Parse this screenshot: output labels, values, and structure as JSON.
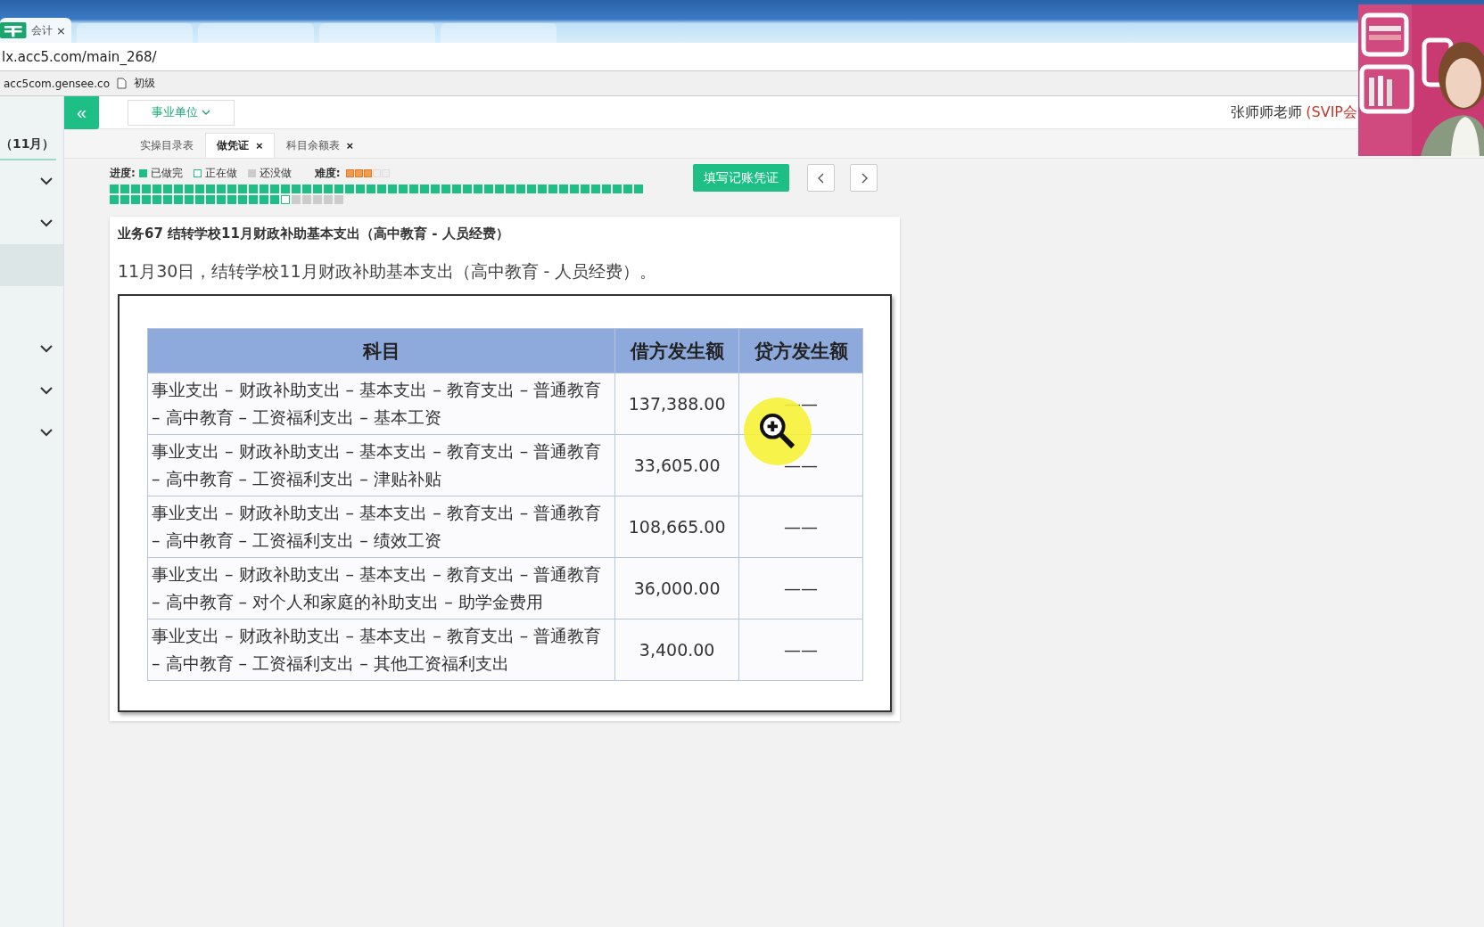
{
  "browser": {
    "tabs": [
      {
        "title": "会计",
        "close": "×",
        "selected": true
      },
      {
        "selected": false
      },
      {
        "selected": false
      },
      {
        "selected": false
      },
      {
        "selected": false
      }
    ],
    "address": "lx.acc5.com/main_268/",
    "bookmarks": [
      {
        "label": "acc5com.gensee.co",
        "kind": "site"
      },
      {
        "label": "初级",
        "kind": "page"
      }
    ]
  },
  "header": {
    "collapse": "«",
    "unit_dropdown": "事业单位",
    "user": "张师师老师",
    "membership": "(SVIP会"
  },
  "tabs": [
    {
      "label": "实操目录表",
      "selected": false
    },
    {
      "label": "做凭证",
      "selected": true,
      "close": "×"
    },
    {
      "label": "科目余额表",
      "selected": false,
      "close": "×"
    }
  ],
  "sidebar": {
    "title": "（11月）",
    "items": [
      {
        "selected": false,
        "kind": "group"
      },
      {
        "selected": false,
        "kind": "group"
      },
      {
        "selected": true,
        "kind": "plain"
      },
      {
        "selected": false,
        "kind": "group"
      },
      {
        "selected": false,
        "kind": "group"
      },
      {
        "selected": false,
        "kind": "group"
      }
    ]
  },
  "progress": {
    "label": "进度:",
    "legend": [
      "已做完",
      "正在做",
      "还没做"
    ],
    "difficulty_label": "难度:",
    "stars": 3,
    "steps": [
      {
        "done": true,
        "current": false
      },
      {
        "done": true,
        "current": false
      },
      {
        "done": true,
        "current": false
      },
      {
        "done": true,
        "current": false
      },
      {
        "done": true,
        "current": false
      },
      {
        "done": true,
        "current": false
      },
      {
        "done": true,
        "current": false
      },
      {
        "done": true,
        "current": false
      },
      {
        "done": true,
        "current": false
      },
      {
        "done": true,
        "current": false
      },
      {
        "done": true,
        "current": false
      },
      {
        "done": true,
        "current": false
      },
      {
        "done": true,
        "current": false
      },
      {
        "done": true,
        "current": false
      },
      {
        "done": true,
        "current": false
      },
      {
        "done": true,
        "current": false
      },
      {
        "done": true,
        "current": false
      },
      {
        "done": true,
        "current": false
      },
      {
        "done": true,
        "current": false
      },
      {
        "done": true,
        "current": false
      },
      {
        "done": true,
        "current": false
      },
      {
        "done": true,
        "current": false
      },
      {
        "done": true,
        "current": false
      },
      {
        "done": true,
        "current": false
      },
      {
        "done": true,
        "current": false
      },
      {
        "done": true,
        "current": false
      },
      {
        "done": true,
        "current": false
      },
      {
        "done": true,
        "current": false
      },
      {
        "done": true,
        "current": false
      },
      {
        "done": true,
        "current": false
      },
      {
        "done": true,
        "current": false
      },
      {
        "done": true,
        "current": false
      },
      {
        "done": true,
        "current": false
      },
      {
        "done": true,
        "current": false
      },
      {
        "done": true,
        "current": false
      },
      {
        "done": true,
        "current": false
      },
      {
        "done": true,
        "current": false
      },
      {
        "done": true,
        "current": false
      },
      {
        "done": true,
        "current": false
      },
      {
        "done": true,
        "current": false
      },
      {
        "done": true,
        "current": false
      },
      {
        "done": true,
        "current": false
      },
      {
        "done": true,
        "current": false
      },
      {
        "done": true,
        "current": false
      },
      {
        "done": true,
        "current": false
      },
      {
        "done": true,
        "current": false
      },
      {
        "done": true,
        "current": false
      },
      {
        "done": true,
        "current": false
      },
      {
        "done": true,
        "current": false
      },
      {
        "done": true,
        "current": false
      },
      {
        "done": true,
        "current": false
      },
      {
        "done": true,
        "current": false
      },
      {
        "done": true,
        "current": false
      },
      {
        "done": true,
        "current": false
      },
      {
        "done": true,
        "current": false
      },
      {
        "done": true,
        "current": false
      },
      {
        "done": true,
        "current": false
      },
      {
        "done": true,
        "current": false
      },
      {
        "done": true,
        "current": false
      },
      {
        "done": true,
        "current": false
      },
      {
        "done": true,
        "current": false
      },
      {
        "done": true,
        "current": false
      },
      {
        "done": true,
        "current": false
      },
      {
        "done": true,
        "current": false
      },
      {
        "done": true,
        "current": false
      },
      {
        "done": true,
        "current": false
      },
      {
        "done": false,
        "current": true
      },
      {
        "done": false,
        "current": false
      },
      {
        "done": false,
        "current": false
      },
      {
        "done": false,
        "current": false
      },
      {
        "done": false,
        "current": false
      },
      {
        "done": false,
        "current": false
      }
    ]
  },
  "actions": {
    "fill_voucher": "填写记账凭证"
  },
  "task": {
    "title": "业务67 结转学校11月财政补助基本支出（高中教育 - 人员经费）",
    "description": "11月30日，结转学校11月财政补助基本支出（高中教育 - 人员经费）。",
    "table": {
      "columns": [
        "科目",
        "借方发生额",
        "贷方发生额"
      ],
      "rows": [
        {
          "account": "事业支出 – 财政补助支出 – 基本支出 – 教育支出 – 普通教育 – 高中教育 – 工资福利支出 – 基本工资",
          "debit": "137,388.00",
          "credit": "——"
        },
        {
          "account": "事业支出 – 财政补助支出 – 基本支出 – 教育支出 – 普通教育 – 高中教育 – 工资福利支出 – 津贴补贴",
          "debit": "33,605.00",
          "credit": "——"
        },
        {
          "account": "事业支出 – 财政补助支出 – 基本支出 – 教育支出 – 普通教育 – 高中教育 – 工资福利支出 – 绩效工资",
          "debit": "108,665.00",
          "credit": "——"
        },
        {
          "account": "事业支出 – 财政补助支出 – 基本支出 – 教育支出 – 普通教育 – 高中教育 – 对个人和家庭的补助支出 – 助学金费用",
          "debit": "36,000.00",
          "credit": "——"
        },
        {
          "account": "事业支出 – 财政补助支出 – 基本支出 – 教育支出 – 普通教育 – 高中教育 – 工资福利支出 – 其他工资福利支出",
          "debit": "3,400.00",
          "credit": "——"
        }
      ]
    }
  }
}
